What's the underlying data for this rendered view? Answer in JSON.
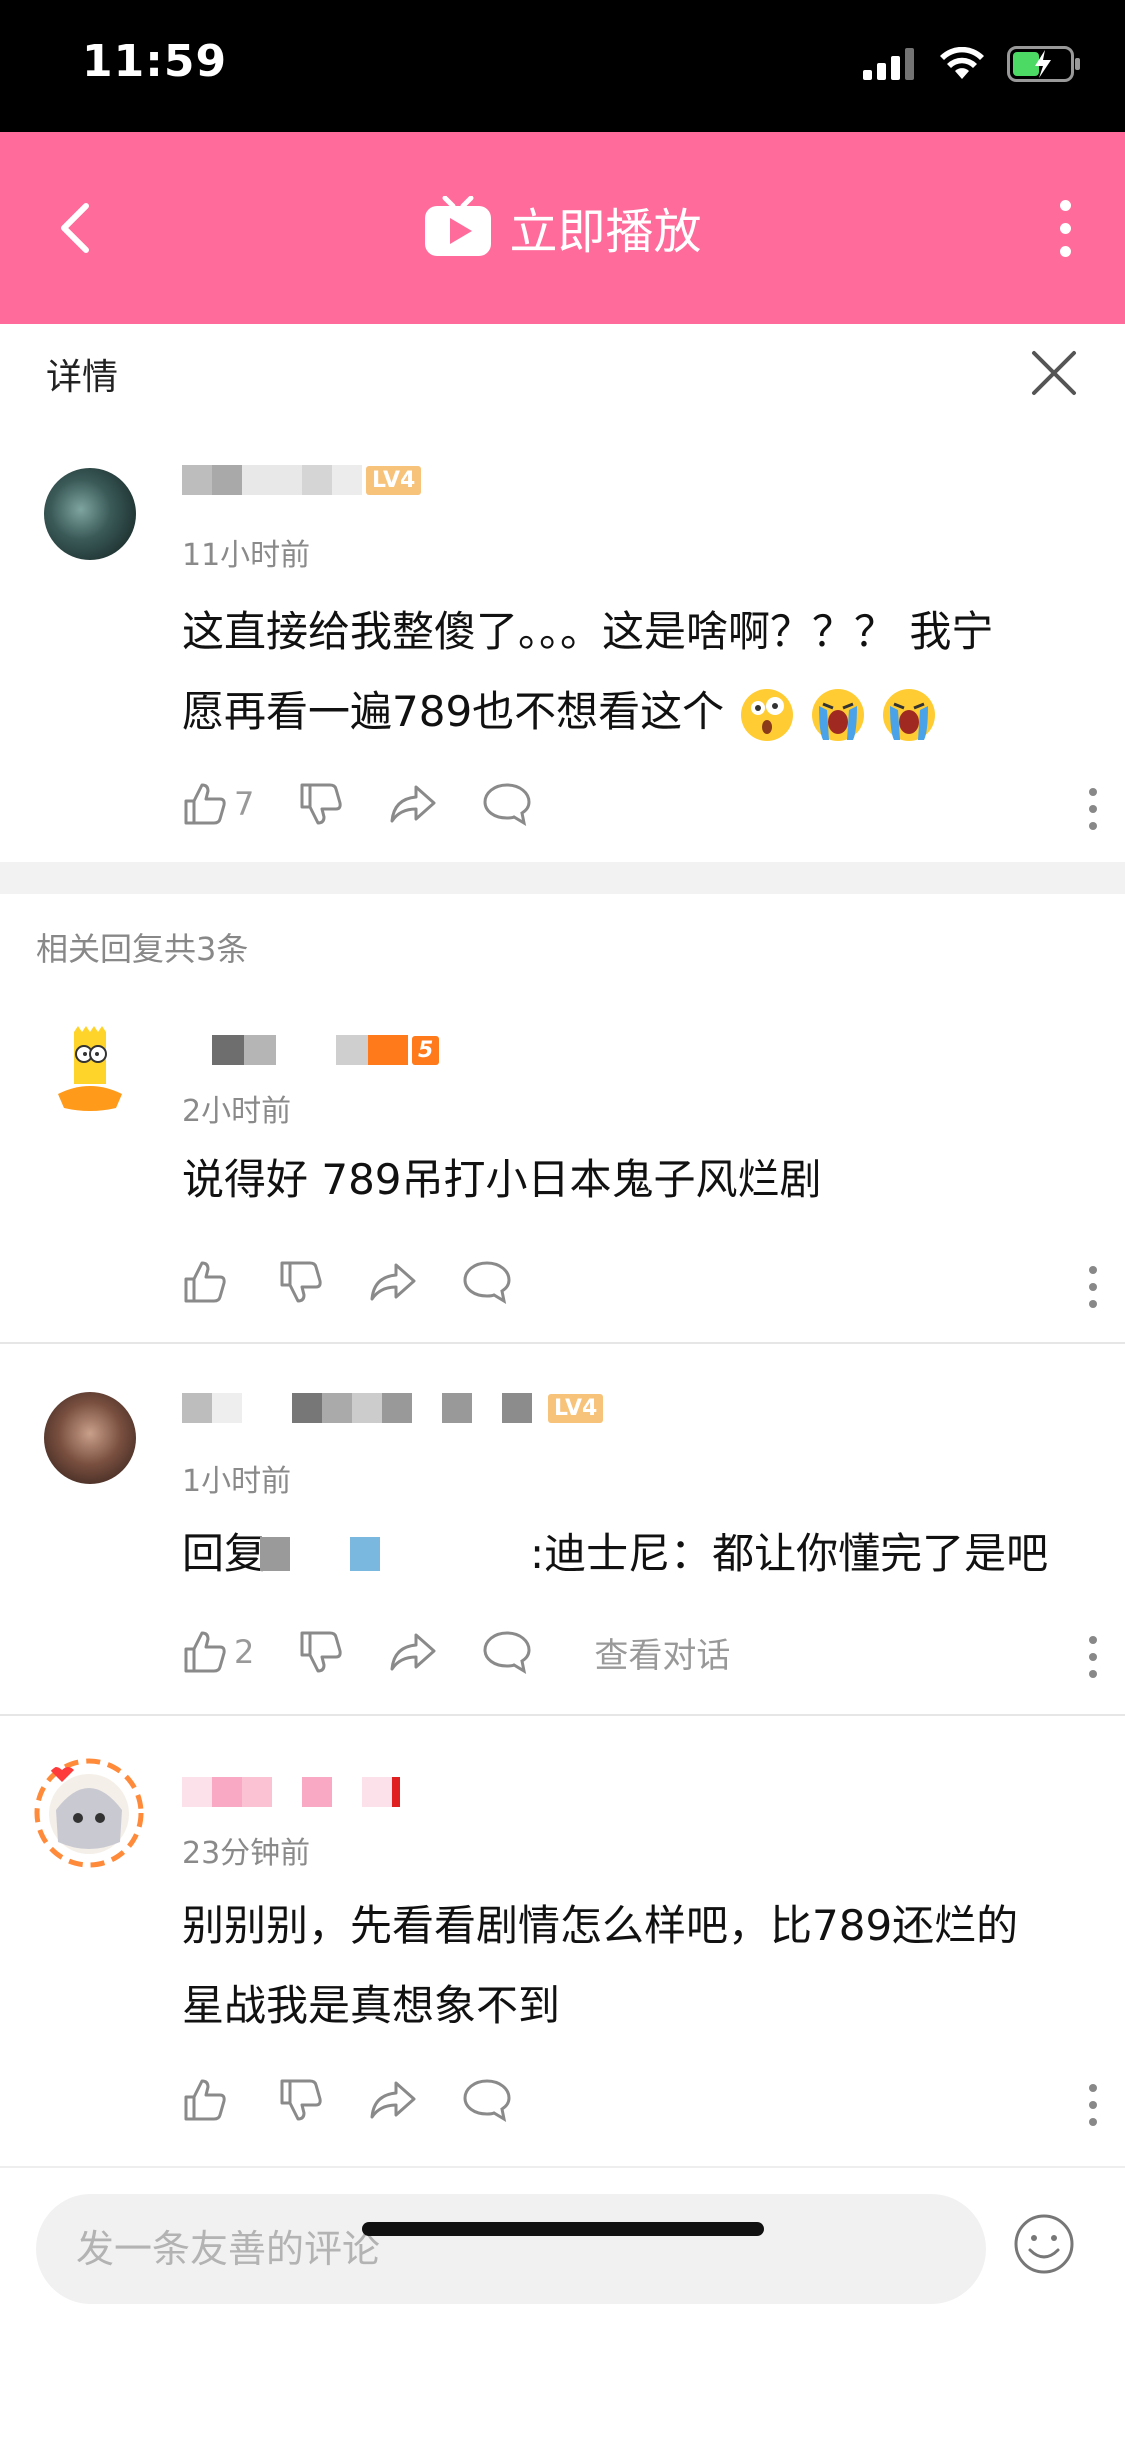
{
  "status_bar": {
    "time": "11:59"
  },
  "header": {
    "title": "立即播放",
    "icon": "tv-play-icon",
    "brand_color": "#ff6b9a"
  },
  "detail": {
    "title": "详情"
  },
  "main_comment": {
    "level": "LV4",
    "time": "11小时前",
    "text_line1": "这直接给我整傻了。。。这是啥啊？？？ 我宁",
    "text_line2": "愿再看一遍789也不想看这个",
    "emojis": [
      "surprised-face-emoji",
      "crying-face-emoji",
      "crying-face-emoji"
    ],
    "likes": "7"
  },
  "replies_header": "相关回复共3条",
  "replies": [
    {
      "level": "5",
      "time": "2小时前",
      "text": "说得好 789吊打小日本鬼子风烂剧",
      "likes": ""
    },
    {
      "level": "LV4",
      "time": "1小时前",
      "text_prefix": "回复",
      "text_suffix": ":迪士尼：都让你懂完了是吧",
      "likes": "2",
      "view_conversation": "查看对话"
    },
    {
      "level": "",
      "time": "23分钟前",
      "text_line1": "别别别，先看看剧情怎么样吧，比789还烂的",
      "text_line2": "星战我是真想象不到",
      "likes": ""
    }
  ],
  "bottom": {
    "placeholder": "发一条友善的评论"
  }
}
